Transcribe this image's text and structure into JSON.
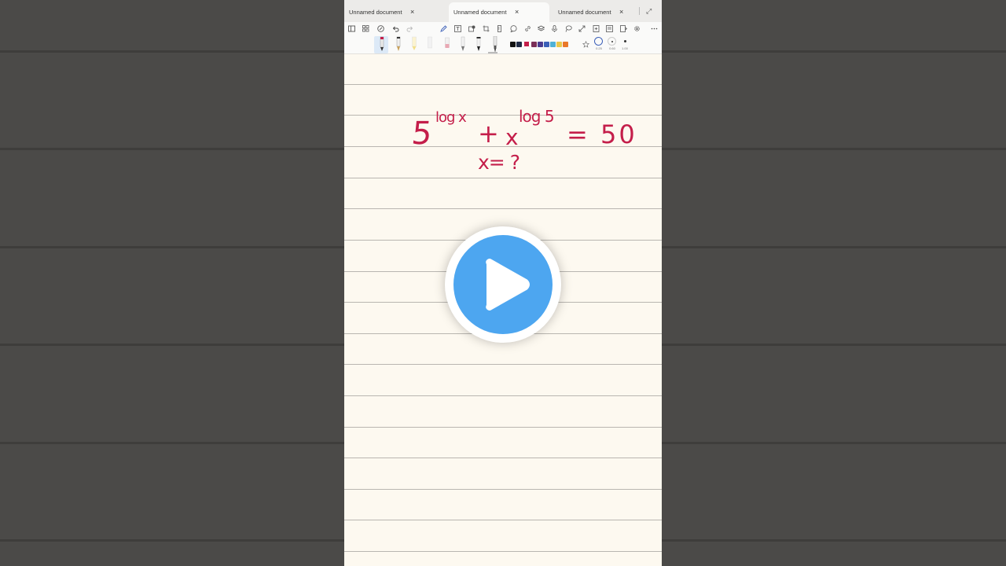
{
  "tabs": [
    {
      "label": "Unnamed document",
      "active": false
    },
    {
      "label": "Unnamed document",
      "active": true
    },
    {
      "label": "Unnamed document",
      "active": false
    }
  ],
  "tab_close_glyph": "×",
  "expand_glyph": "⤢",
  "toolbar_icons": [
    "sidebar-icon",
    "grid-icon",
    "pen-circle-icon",
    "undo-icon",
    "redo-icon",
    "pencil-icon",
    "text-icon",
    "shape-icon",
    "crop-icon",
    "ruler-icon",
    "comment-icon",
    "link-icon",
    "layers-icon",
    "mic-icon",
    "lasso-icon",
    "expand-icon",
    "add-page-icon",
    "page-icon",
    "split-icon",
    "settings-icon",
    "more-icon"
  ],
  "colors": {
    "ink": "#c41e4a",
    "accent": "#4da6f0",
    "swatches": [
      "#111111",
      "#1f2a44",
      "#c41e4a",
      "#7a2e57",
      "#4b3b8f",
      "#3b5fb8",
      "#4fb1d6",
      "#e9c84a",
      "#e9782a"
    ]
  },
  "stroke_sizes": [
    "0.25",
    "0.60",
    "1.00"
  ],
  "handwriting": {
    "base": "5",
    "exp1": "log x",
    "plus": "+",
    "x": "x",
    "exp2": "log 5",
    "equals": "= 50",
    "question": "x= ?"
  }
}
